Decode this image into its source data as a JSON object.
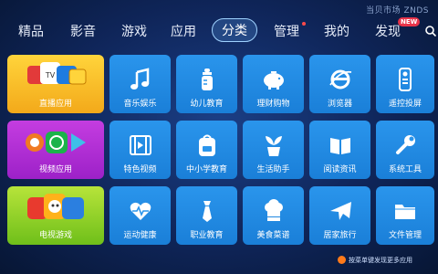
{
  "watermark": "当贝市场 ZNDS",
  "nav": {
    "items": [
      "精品",
      "影音",
      "游戏",
      "应用",
      "分类",
      "管理",
      "我的",
      "发现"
    ],
    "active_index": 4,
    "new_badge": "NEW"
  },
  "tiles_big": [
    {
      "label": "直播应用",
      "color": "yellow"
    },
    {
      "label": "视频应用",
      "color": "purple"
    },
    {
      "label": "电视游戏",
      "color": "green"
    }
  ],
  "tiles": [
    {
      "label": "音乐娱乐",
      "icon": "music-note-icon"
    },
    {
      "label": "幼儿教育",
      "icon": "baby-bottle-icon"
    },
    {
      "label": "理财购物",
      "icon": "piggy-bank-icon"
    },
    {
      "label": "浏览器",
      "icon": "browser-e-icon"
    },
    {
      "label": "遥控投屏",
      "icon": "remote-control-icon"
    },
    {
      "label": "特色视频",
      "icon": "film-strip-icon"
    },
    {
      "label": "中小学教育",
      "icon": "school-bag-icon"
    },
    {
      "label": "生活助手",
      "icon": "plant-pot-icon"
    },
    {
      "label": "阅读资讯",
      "icon": "open-book-icon"
    },
    {
      "label": "系统工具",
      "icon": "wrench-icon"
    },
    {
      "label": "运动健康",
      "icon": "heart-pulse-icon"
    },
    {
      "label": "职业教育",
      "icon": "necktie-icon"
    },
    {
      "label": "美食菜谱",
      "icon": "chef-hat-icon"
    },
    {
      "label": "居家旅行",
      "icon": "airplane-icon"
    },
    {
      "label": "文件管理",
      "icon": "folder-icon"
    }
  ],
  "hint": "按菜单键发现更多应用",
  "colors": {
    "accent": "#2a95ec",
    "active_border": "#9fd2ff",
    "badge": "#e8344a"
  }
}
